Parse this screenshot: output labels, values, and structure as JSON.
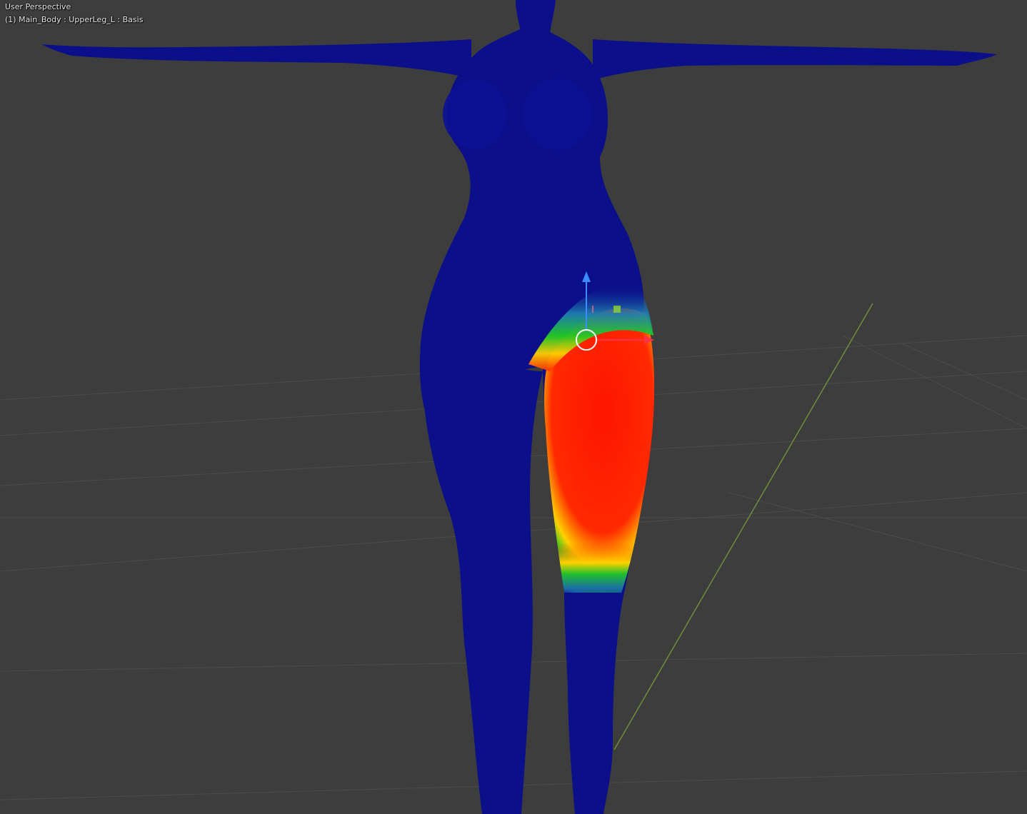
{
  "viewport": {
    "view_mode": "User Perspective",
    "object_info": "(1) Main_Body : UpperLeg_L : Basis"
  },
  "colors": {
    "background": "#3d3d3d",
    "grid_line": "#4a4a4a",
    "y_axis_line": "#6f8f3a",
    "body_zero_weight": "#0b0f8a",
    "weight_full": "#ff1a00",
    "weight_high": "#ffcc00",
    "weight_mid": "#22cc22",
    "weight_low": "#1f7fb0",
    "gizmo_z": "#3a8cff",
    "gizmo_x": "#ff3348",
    "gizmo_y": "#8acb3a",
    "pivot_circle": "#ffffff"
  },
  "gizmo": {
    "axes": [
      "z-axis-arrow",
      "x-axis-arrow",
      "y-plane-handle"
    ]
  }
}
